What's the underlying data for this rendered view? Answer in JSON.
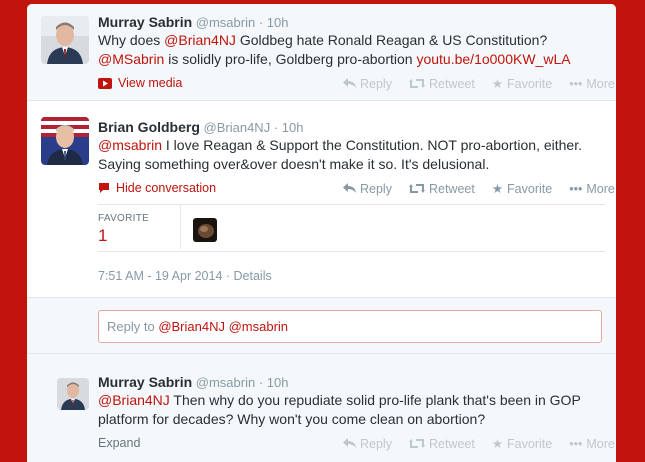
{
  "tweet1": {
    "fullname": "Murray Sabrin",
    "handle": "@msabrin",
    "sep": "·",
    "time": "10h",
    "line1_pre": "Why does ",
    "line1_mention": "@Brian4NJ",
    "line1_post": " Goldbeg hate Ronald Reagan & US Constitution?",
    "line2_mention": "@MSabrin",
    "line2_mid": " is solidly pro-life, Goldberg pro-abortion ",
    "line2_link": "youtu.be/1o000KW_wLA",
    "view_media": "View media",
    "actions": {
      "reply": "Reply",
      "retweet": "Retweet",
      "favorite": "Favorite",
      "more": "More"
    }
  },
  "tweet2": {
    "fullname": "Brian Goldberg",
    "handle": "@Brian4NJ",
    "sep": "·",
    "time": "10h",
    "line1_mention": "@msabrin",
    "line1_post": " I love Reagan & Support the Constitution. NOT pro-abortion, either.",
    "line2": "Saying something over&over doesn't make it so. It's delusional.",
    "hide_conversation": "Hide conversation",
    "actions": {
      "reply": "Reply",
      "retweet": "Retweet",
      "favorite": "Favorite",
      "more": "More"
    },
    "favorite_label": "FAVORITE",
    "favorite_count": "1",
    "timestamp": "7:51 AM - 19 Apr 2014",
    "dot": "·",
    "details": "Details"
  },
  "reply_box": {
    "prefix": "Reply to ",
    "mentions": "@Brian4NJ @msabrin"
  },
  "tweet3": {
    "fullname": "Murray Sabrin",
    "handle": "@msabrin",
    "sep": "·",
    "time": "10h",
    "line1_mention": "@Brian4NJ",
    "line1_post": " Then why do you repudiate solid pro-life plank that's been in GOP",
    "line2": "platform for decades? Why won't you come clean on abortion?",
    "expand": "Expand",
    "actions": {
      "reply": "Reply",
      "retweet": "Retweet",
      "favorite": "Favorite",
      "more": "More"
    }
  },
  "colors": {
    "accent": "#c0140d",
    "background": "#c0140d"
  }
}
